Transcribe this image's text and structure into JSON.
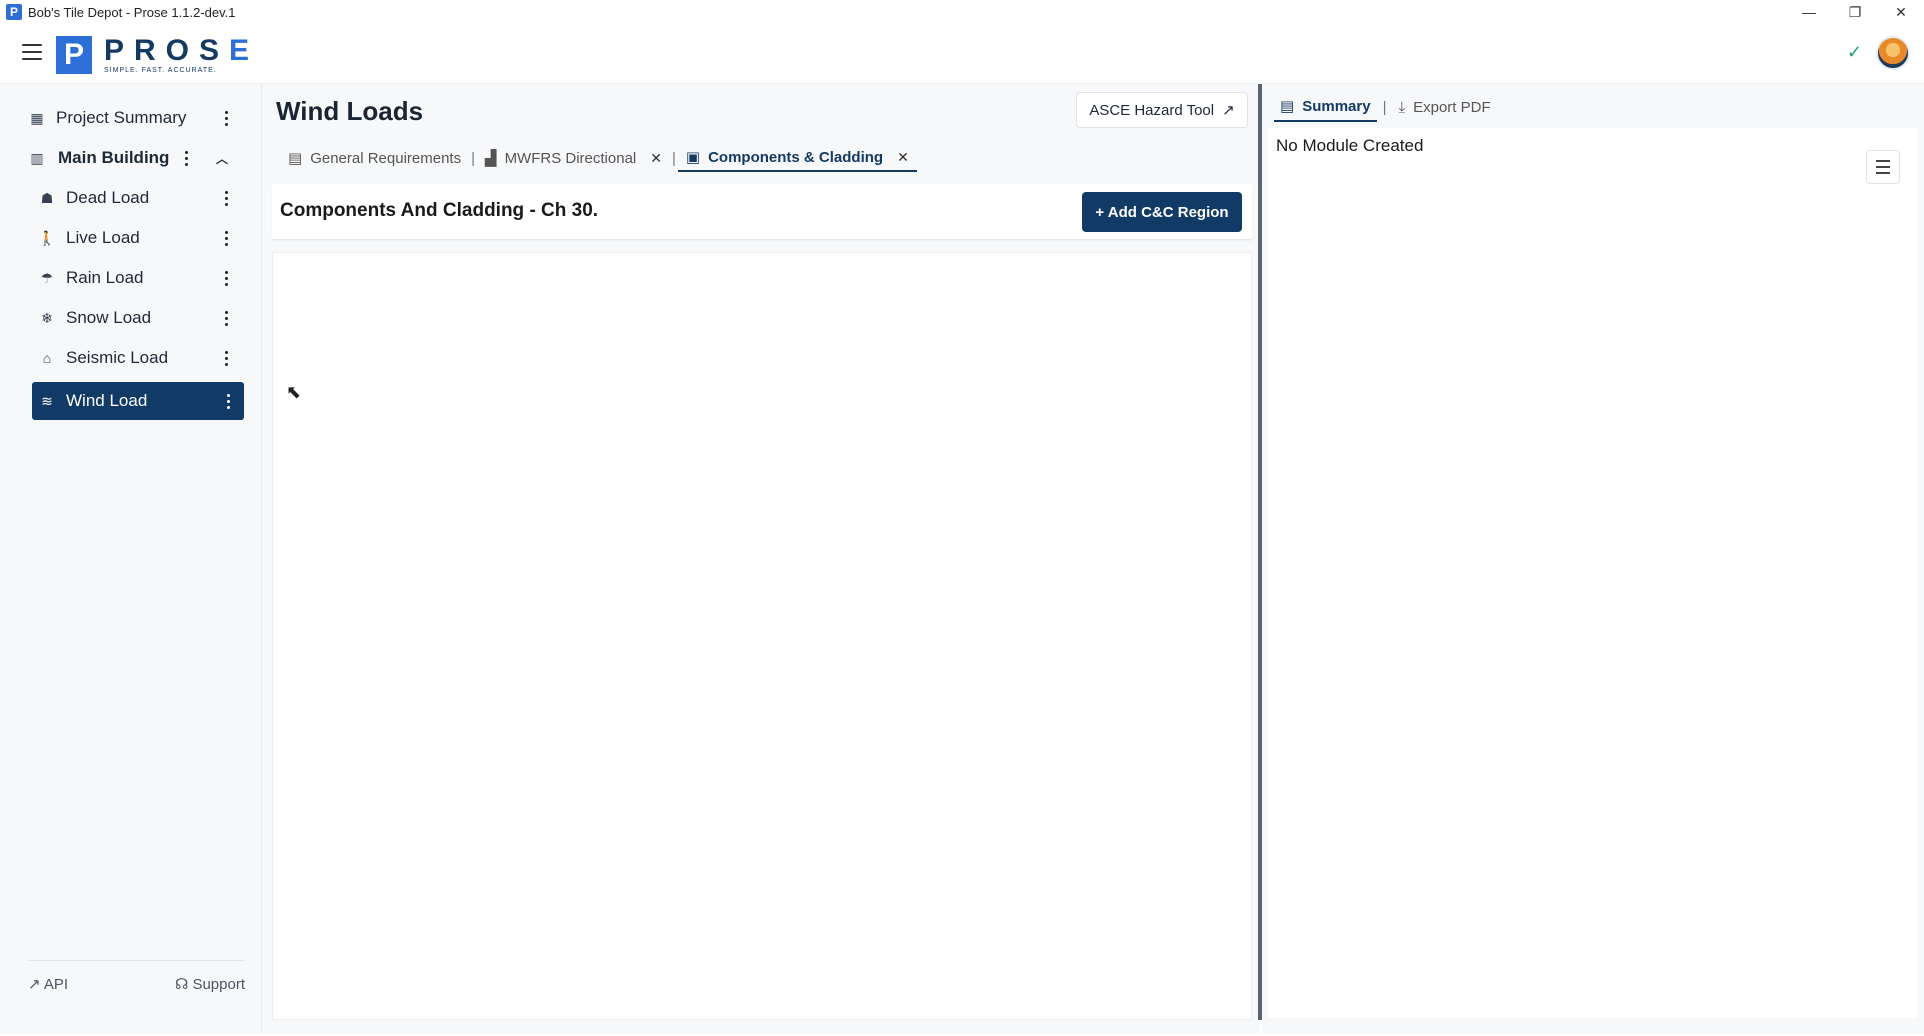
{
  "window": {
    "title": "Bob's Tile Depot - Prose 1.1.2-dev.1",
    "app_icon_letter": "P",
    "minimize": "—",
    "maximize": "❐",
    "close": "✕"
  },
  "header": {
    "logo_letter": "P",
    "logo_word": "PROS",
    "logo_word_e": "E",
    "logo_tagline": "SIMPLE. FAST. ACCURATE.",
    "status_icon": "✓"
  },
  "sidebar": {
    "project_summary": "Project Summary",
    "main_building": "Main Building",
    "items": [
      {
        "label": "Dead Load",
        "icon": "☗"
      },
      {
        "label": "Live Load",
        "icon": "🚶"
      },
      {
        "label": "Rain Load",
        "icon": "☂"
      },
      {
        "label": "Snow Load",
        "icon": "❄"
      },
      {
        "label": "Seismic Load",
        "icon": "⌂"
      },
      {
        "label": "Wind Load",
        "icon": "≋"
      }
    ],
    "api": "API",
    "support": "Support"
  },
  "main": {
    "title": "Wind Loads",
    "hazard_tool": "ASCE Hazard Tool",
    "tabs": [
      {
        "label": "General Requirements"
      },
      {
        "label": "MWFRS Directional"
      },
      {
        "label": "Components & Cladding"
      }
    ],
    "section_title": "Components And Cladding - Ch 30.",
    "add_button": "+ Add C&C Region"
  },
  "right": {
    "summary_tab": "Summary",
    "export_tab": "Export PDF",
    "empty_message": "No Module Created"
  },
  "colors": {
    "brand_navy": "#123a66",
    "brand_blue": "#2d6fd6",
    "ok_green": "#22a06b"
  }
}
